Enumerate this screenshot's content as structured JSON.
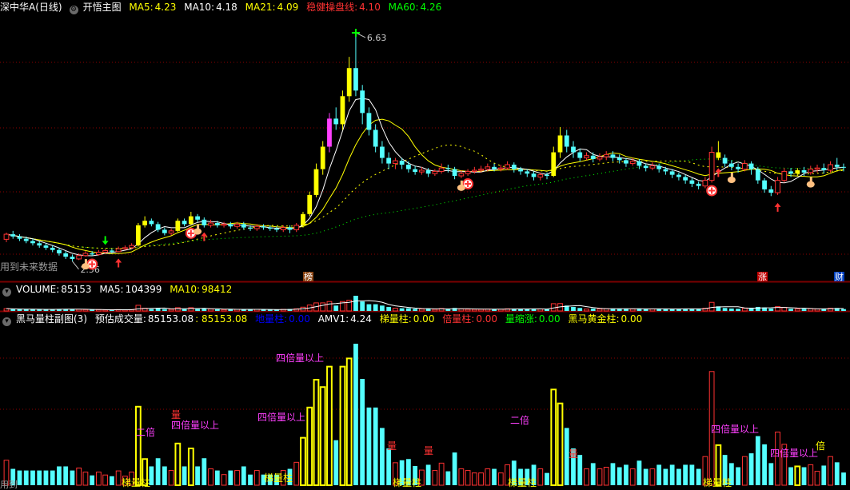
{
  "main_header": {
    "title": "深中华A(日线)",
    "template": "开悟主图",
    "ma5_label": "MA5:",
    "ma5_value": "4.23",
    "ma10_label": "MA10:",
    "ma10_value": "4.18",
    "ma21_label": "MA21:",
    "ma21_value": "4.09",
    "stable_label": "稳健操盘线:",
    "stable_value": "4.10",
    "ma60_label": "MA60:",
    "ma60_value": "4.26"
  },
  "volume_header": {
    "title": "VOLUME:",
    "volume_value": "85153",
    "ma5_label": "MA5:",
    "ma5_value": "104399",
    "ma10_label": "MA10:",
    "ma10_value": "98412"
  },
  "sub_header": {
    "title": "黑马量柱副图(3)",
    "est_label": "预估成交量:",
    "est_value": "85153.08",
    "est2_value": ": 85153.08",
    "low_label": "地量柱:",
    "low_value": "0.00",
    "amv_label": "AMV1:",
    "amv_value": "4.24",
    "ladder_label": "梯量柱:",
    "ladder_value": "0.00",
    "double_label": "倍量柱:",
    "double_value": "0.00",
    "shrink_label": "量缩涨:",
    "shrink_value": "0.00",
    "gold_label": "黑马黄金柱:",
    "gold_value": "0.00"
  },
  "labels": {
    "high_price": "6.63",
    "low_price": "2.56",
    "future_note": "用到未来数据",
    "tag_bang": "榜",
    "tag_zhang": "涨",
    "tag_cai": "财",
    "bottom_note": "用到"
  },
  "sub_annotations": {
    "two_times": "二倍",
    "four_times": "四倍量以上",
    "liang": "量",
    "ladder": "梯量柱",
    "bei": "倍"
  },
  "colors": {
    "up": "#ff3232",
    "down": "#54ffff",
    "yellow": "#ffff00",
    "magenta": "#ff40ff",
    "white": "#ffffff",
    "green": "#00ff00",
    "orange": "#ff8000",
    "blue": "#0000ff",
    "grid": "#8b0000"
  },
  "chart_data": {
    "type": "candlestick",
    "panels": [
      "price",
      "volume",
      "black-horse-volume"
    ],
    "price_range": [
      2.56,
      6.63
    ],
    "price_high": 6.63,
    "price_low": 2.56,
    "last_values": {
      "MA5": 4.23,
      "MA10": 4.18,
      "MA21": 4.09,
      "稳健操盘线": 4.1,
      "MA60": 4.26,
      "VOLUME": 85153,
      "VOL_MA5": 104399,
      "VOL_MA10": 98412,
      "预估成交量": 85153.08,
      "AMV1": 4.24
    },
    "series": {
      "candles": [
        [
          2.95,
          3.04,
          3.07,
          2.9
        ],
        [
          3.04,
          3.0,
          3.1,
          2.96
        ],
        [
          3.0,
          2.96,
          3.04,
          2.92
        ],
        [
          2.96,
          2.92,
          3.0,
          2.88
        ],
        [
          2.92,
          2.88,
          2.96,
          2.84
        ],
        [
          2.88,
          2.84,
          2.92,
          2.8
        ],
        [
          2.84,
          2.8,
          2.88,
          2.76
        ],
        [
          2.8,
          2.76,
          2.84,
          2.72
        ],
        [
          2.76,
          2.7,
          2.8,
          2.66
        ],
        [
          2.7,
          2.64,
          2.74,
          2.6
        ],
        [
          2.64,
          2.6,
          2.68,
          2.56
        ],
        [
          2.6,
          2.66,
          2.7,
          2.58
        ],
        [
          2.66,
          2.7,
          2.74,
          2.64
        ],
        [
          2.7,
          2.68,
          2.74,
          2.65
        ],
        [
          2.68,
          2.72,
          2.76,
          2.66
        ],
        [
          2.72,
          2.75,
          2.78,
          2.7
        ],
        [
          2.75,
          2.73,
          2.78,
          2.7
        ],
        [
          2.73,
          2.78,
          2.82,
          2.72
        ],
        [
          2.78,
          2.8,
          2.84,
          2.76
        ],
        [
          2.8,
          2.84,
          2.88,
          2.78
        ],
        [
          2.84,
          3.2,
          3.24,
          2.82
        ],
        [
          3.2,
          3.28,
          3.36,
          3.16
        ],
        [
          3.28,
          3.22,
          3.32,
          3.18
        ],
        [
          3.22,
          3.12,
          3.26,
          3.08
        ],
        [
          3.12,
          3.06,
          3.16,
          3.02
        ],
        [
          3.06,
          3.1,
          3.14,
          3.02
        ],
        [
          3.1,
          3.28,
          3.32,
          3.08
        ],
        [
          3.28,
          3.22,
          3.32,
          3.18
        ],
        [
          3.22,
          3.36,
          3.44,
          3.2
        ],
        [
          3.36,
          3.3,
          3.4,
          3.26
        ],
        [
          3.3,
          3.2,
          3.34,
          3.16
        ],
        [
          3.2,
          3.24,
          3.3,
          3.16
        ],
        [
          3.24,
          3.2,
          3.28,
          3.16
        ],
        [
          3.2,
          3.22,
          3.26,
          3.16
        ],
        [
          3.22,
          3.18,
          3.26,
          3.14
        ],
        [
          3.18,
          3.22,
          3.26,
          3.14
        ],
        [
          3.22,
          3.16,
          3.26,
          3.12
        ],
        [
          3.16,
          3.14,
          3.2,
          3.1
        ],
        [
          3.14,
          3.18,
          3.22,
          3.1
        ],
        [
          3.18,
          3.16,
          3.22,
          3.12
        ],
        [
          3.16,
          3.14,
          3.2,
          3.1
        ],
        [
          3.14,
          3.12,
          3.18,
          3.08
        ],
        [
          3.12,
          3.16,
          3.2,
          3.08
        ],
        [
          3.16,
          3.12,
          3.2,
          3.06
        ],
        [
          3.12,
          3.2,
          3.24,
          3.08
        ],
        [
          3.2,
          3.4,
          3.44,
          3.16
        ],
        [
          3.4,
          3.74,
          3.8,
          3.36
        ],
        [
          3.74,
          4.2,
          4.3,
          3.7
        ],
        [
          4.2,
          4.6,
          4.7,
          4.1
        ],
        [
          4.6,
          5.1,
          5.2,
          4.5
        ],
        [
          5.1,
          5.0,
          5.3,
          4.9
        ],
        [
          5.0,
          5.5,
          5.6,
          4.9
        ],
        [
          5.5,
          6.0,
          6.2,
          5.4
        ],
        [
          6.0,
          5.6,
          6.63,
          5.5
        ],
        [
          5.6,
          5.2,
          5.7,
          5.0
        ],
        [
          5.2,
          4.9,
          5.3,
          4.8
        ],
        [
          4.9,
          4.6,
          5.0,
          4.5
        ],
        [
          4.6,
          4.4,
          4.7,
          4.3
        ],
        [
          4.4,
          4.3,
          4.5,
          4.2
        ],
        [
          4.3,
          4.35,
          4.4,
          4.2
        ],
        [
          4.35,
          4.28,
          4.4,
          4.2
        ],
        [
          4.28,
          4.2,
          4.34,
          4.14
        ],
        [
          4.2,
          4.15,
          4.26,
          4.1
        ],
        [
          4.15,
          4.18,
          4.24,
          4.1
        ],
        [
          4.18,
          4.12,
          4.22,
          4.06
        ],
        [
          4.12,
          4.16,
          4.2,
          4.08
        ],
        [
          4.16,
          4.22,
          4.3,
          4.12
        ],
        [
          4.22,
          4.2,
          4.28,
          4.14
        ],
        [
          4.2,
          4.08,
          4.24,
          4.02
        ],
        [
          4.08,
          4.12,
          4.18,
          4.04
        ],
        [
          4.12,
          4.16,
          4.2,
          4.08
        ],
        [
          4.16,
          4.18,
          4.24,
          4.12
        ],
        [
          4.18,
          4.2,
          4.26,
          4.14
        ],
        [
          4.2,
          4.24,
          4.3,
          4.16
        ],
        [
          4.24,
          4.2,
          4.3,
          4.16
        ],
        [
          4.2,
          4.22,
          4.28,
          4.16
        ],
        [
          4.22,
          4.28,
          4.34,
          4.18
        ],
        [
          4.28,
          4.2,
          4.32,
          4.14
        ],
        [
          4.2,
          4.16,
          4.24,
          4.1
        ],
        [
          4.16,
          4.12,
          4.2,
          4.06
        ],
        [
          4.12,
          4.06,
          4.16,
          4.0
        ],
        [
          4.06,
          4.1,
          4.14,
          4.0
        ],
        [
          4.1,
          4.08,
          4.14,
          4.02
        ],
        [
          4.08,
          4.5,
          4.6,
          4.06
        ],
        [
          4.5,
          4.8,
          4.95,
          4.4
        ],
        [
          4.8,
          4.6,
          4.9,
          4.5
        ],
        [
          4.6,
          4.5,
          4.7,
          4.4
        ],
        [
          4.5,
          4.4,
          4.56,
          4.34
        ],
        [
          4.4,
          4.44,
          4.5,
          4.36
        ],
        [
          4.44,
          4.38,
          4.5,
          4.32
        ],
        [
          4.38,
          4.42,
          4.48,
          4.34
        ],
        [
          4.42,
          4.46,
          4.52,
          4.36
        ],
        [
          4.46,
          4.4,
          4.52,
          4.34
        ],
        [
          4.4,
          4.36,
          4.46,
          4.3
        ],
        [
          4.36,
          4.3,
          4.4,
          4.24
        ],
        [
          4.3,
          4.34,
          4.4,
          4.26
        ],
        [
          4.34,
          4.26,
          4.38,
          4.2
        ],
        [
          4.26,
          4.22,
          4.3,
          4.16
        ],
        [
          4.22,
          4.26,
          4.32,
          4.18
        ],
        [
          4.26,
          4.2,
          4.3,
          4.14
        ],
        [
          4.2,
          4.16,
          4.24,
          4.1
        ],
        [
          4.16,
          4.1,
          4.2,
          4.04
        ],
        [
          4.1,
          4.06,
          4.14,
          4.0
        ],
        [
          4.06,
          4.0,
          4.1,
          3.94
        ],
        [
          4.0,
          3.94,
          4.04,
          3.88
        ],
        [
          3.94,
          3.9,
          3.98,
          3.84
        ],
        [
          3.9,
          4.0,
          4.06,
          3.86
        ],
        [
          4.0,
          4.5,
          4.6,
          3.96
        ],
        [
          4.5,
          4.4,
          4.7,
          4.36
        ],
        [
          4.4,
          4.3,
          4.46,
          4.24
        ],
        [
          4.3,
          4.24,
          4.36,
          4.18
        ],
        [
          4.24,
          4.2,
          4.3,
          4.14
        ],
        [
          4.2,
          4.3,
          4.36,
          4.16
        ],
        [
          4.3,
          4.2,
          4.34,
          4.1
        ],
        [
          4.2,
          4.0,
          4.24,
          3.94
        ],
        [
          4.0,
          3.84,
          4.04,
          3.78
        ],
        [
          3.84,
          3.78,
          3.9,
          3.72
        ],
        [
          3.78,
          4.0,
          4.06,
          3.74
        ],
        [
          4.0,
          4.16,
          4.22,
          3.96
        ],
        [
          4.16,
          4.12,
          4.22,
          4.06
        ],
        [
          4.12,
          4.18,
          4.22,
          4.08
        ],
        [
          4.18,
          4.14,
          4.24,
          4.08
        ],
        [
          4.14,
          4.2,
          4.26,
          4.1
        ],
        [
          4.2,
          4.22,
          4.28,
          4.14
        ],
        [
          4.22,
          4.18,
          4.3,
          4.12
        ],
        [
          4.18,
          4.28,
          4.34,
          4.14
        ],
        [
          4.28,
          4.24,
          4.4,
          4.18
        ],
        [
          4.24,
          4.23,
          4.3,
          4.16
        ]
      ]
    }
  }
}
